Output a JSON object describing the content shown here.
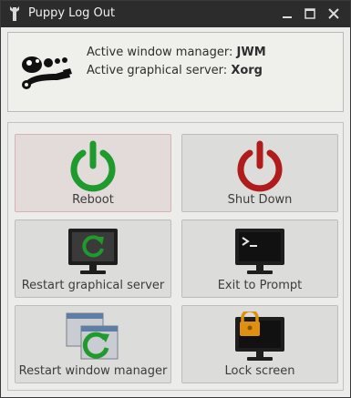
{
  "window": {
    "title": "Puppy Log Out",
    "controls": [
      "minimize-icon",
      "maximize-icon",
      "close-icon"
    ]
  },
  "info": {
    "wm_label": "Active window manager: ",
    "wm_value": "JWM",
    "server_label": "Active graphical server: ",
    "server_value": "Xorg"
  },
  "buttons": {
    "reboot": "Reboot",
    "shutdown": "Shut Down",
    "restart_server": "Restart graphical server",
    "exit_prompt": "Exit to Prompt",
    "restart_wm": "Restart window manager",
    "lock": "Lock screen"
  },
  "colors": {
    "reboot_green": "#1f9a2c",
    "shutdown_red": "#b01c1c",
    "lock_orange": "#e0900f",
    "monitor_dark": "#1e1e1e"
  }
}
